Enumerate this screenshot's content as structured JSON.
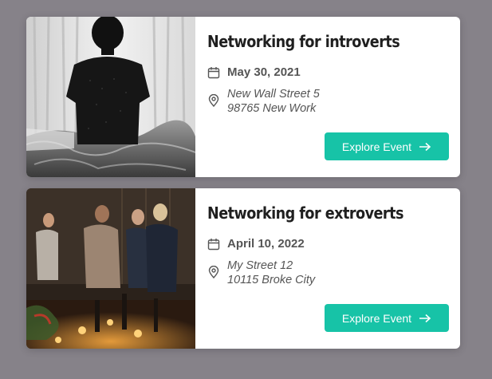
{
  "events": [
    {
      "title": "Networking for introverts",
      "date": "May 30, 2021",
      "address_line1": "New Wall Street 5",
      "address_line2": "98765 New Work",
      "button_label": "Explore Event"
    },
    {
      "title": "Networking for extroverts",
      "date": "April 10, 2022",
      "address_line1": "My Street 12",
      "address_line2": "10115 Broke City",
      "button_label": "Explore Event"
    }
  ],
  "icons": {
    "date": "calendar-icon",
    "location": "map-pin-icon",
    "button": "arrow-right-icon"
  },
  "colors": {
    "background": "#868289",
    "card": "#ffffff",
    "accent": "#17c3a7",
    "title": "#1f1f1f",
    "meta": "#555555"
  }
}
